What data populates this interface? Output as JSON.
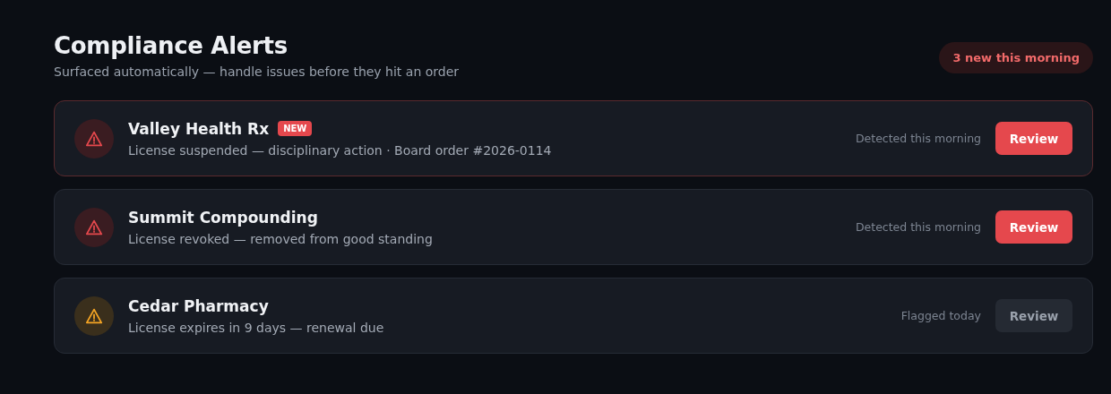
{
  "header": {
    "title": "Compliance Alerts",
    "subtitle": "Surfaced automatically — handle issues before they hit an order",
    "badge": "3 new this morning"
  },
  "alerts": [
    {
      "name": "Valley Health Rx",
      "badge": "NEW",
      "highlighted": true,
      "kind": "critical",
      "detail": "License suspended — disciplinary action · Board order #2026-0114",
      "time": "Detected this morning",
      "action": {
        "label": "Review",
        "kind": "primary"
      }
    },
    {
      "name": "Summit Compounding",
      "highlighted": false,
      "kind": "critical",
      "detail": "License revoked — removed from good standing",
      "time": "Detected this morning",
      "action": {
        "label": "Review",
        "kind": "primary"
      }
    },
    {
      "name": "Cedar Pharmacy",
      "highlighted": false,
      "kind": "warning",
      "detail": "License expires in 9 days — renewal due",
      "time": "Flagged today",
      "action": {
        "label": "Review",
        "kind": "secondary"
      }
    }
  ]
}
